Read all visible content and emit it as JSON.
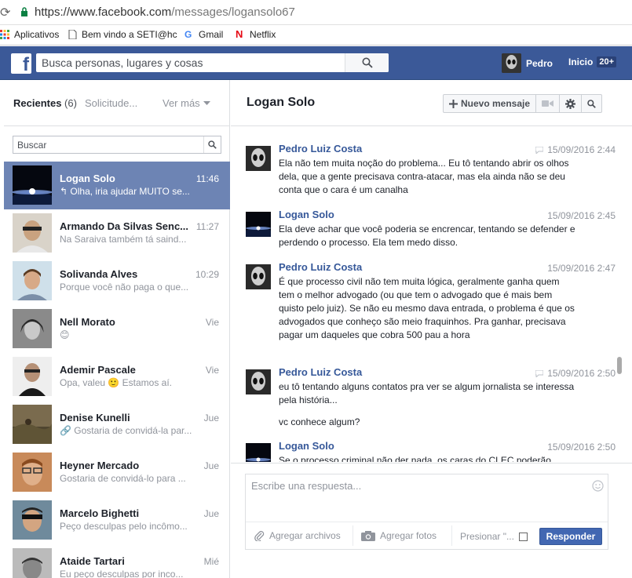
{
  "browser": {
    "url_domain": "https://www.facebook.com",
    "url_path": "/messages/logansolo67",
    "bookmarks": [
      {
        "label": "Aplicativos",
        "icon": "apps-grid-icon"
      },
      {
        "label": "Bem vindo a SETI@hc",
        "icon": "page-icon"
      },
      {
        "label": "Gmail",
        "icon": "google-icon"
      },
      {
        "label": "Netflix",
        "icon": "netflix-icon"
      }
    ]
  },
  "topbar": {
    "logo": "f",
    "search_placeholder": "Busca personas, lugares y cosas",
    "user_name": "Pedro",
    "home_label": "Inicio",
    "home_badge": "20+"
  },
  "left": {
    "recent_label": "Recientes",
    "recent_count": "(6)",
    "requests_label": "Solicitude...",
    "more_label": "Ver más",
    "search_placeholder": "Buscar",
    "threads": [
      {
        "name": "Logan Solo",
        "time": "11:46",
        "snippet": "↰ Olha, iria ajudar MUITO se...",
        "active": true
      },
      {
        "name": "Armando Da Silvas Senc...",
        "time": "11:27",
        "snippet": "Na Saraiva também tá saind..."
      },
      {
        "name": "Solivanda Alves",
        "time": "10:29",
        "snippet": "Porque você não paga o que..."
      },
      {
        "name": "Nell Morato",
        "time": "Vie",
        "snippet": "😊"
      },
      {
        "name": "Ademir Pascale",
        "time": "Vie",
        "snippet": "Opa, valeu 🙂 Estamos aí."
      },
      {
        "name": "Denise Kunelli",
        "time": "Jue",
        "snippet": "🔗 Gostaria de convidá-la par..."
      },
      {
        "name": "Heyner Mercado",
        "time": "Jue",
        "snippet": "Gostaria de convidá-lo para ..."
      },
      {
        "name": "Marcelo Bighetti",
        "time": "Jue",
        "snippet": "Peço desculpas pelo incômo..."
      },
      {
        "name": "Ataide Tartari",
        "time": "Mié",
        "snippet": "Eu peço desculpas por inco..."
      }
    ]
  },
  "conversation": {
    "name": "Logan Solo",
    "new_message_label": "Nuevo mensaje",
    "messages": [
      {
        "sender": "Pedro Luiz Costa",
        "time": "15/09/2016 2:44",
        "text": "Ela não tem muita noção do problema... Eu tô tentando abrir os olhos dela, que a gente precisava contra-atacar, mas ela ainda não se deu conta que o cara é um canalha"
      },
      {
        "sender": "Logan Solo",
        "time": "15/09/2016 2:45",
        "text": "Ela deve achar que você poderia se encrencar, tentando se defender e perdendo o processo. Ela tem medo disso."
      },
      {
        "sender": "Pedro Luiz Costa",
        "time": "15/09/2016 2:47",
        "text": "É que processo civil não tem muita lógica, geralmente ganha quem tem o melhor advogado (ou que tem o advogado que é mais bem quisto pelo juiz). Se não eu mesmo dava entrada, o problema é que os advogados que conheço são meio fraquinhos. Pra ganhar, precisava pagar um daqueles que cobra 500 pau a hora"
      },
      {
        "sender": "Pedro Luiz Costa",
        "time": "15/09/2016 2:50",
        "text": "eu tô tentando alguns contatos pra ver se algum jornalista se interessa pela história...",
        "text2": "vc conhece algum?"
      },
      {
        "sender": "Logan Solo",
        "time": "15/09/2016 2:50",
        "text": "Se o processo criminal não der nada, os caras do CLEC poderão"
      }
    ]
  },
  "composer": {
    "placeholder": "Escribe una respuesta...",
    "attach_label": "Agregar archivos",
    "photos_label": "Agregar fotos",
    "enter_label": "Presionar \"...",
    "send_label": "Responder"
  }
}
